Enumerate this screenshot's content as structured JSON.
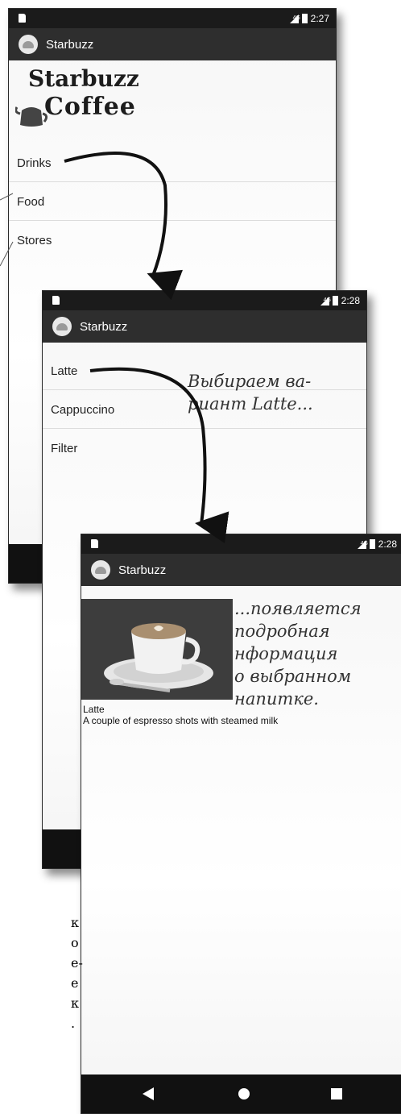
{
  "screen1": {
    "time": "2:27",
    "network": "4G",
    "app_title": "Starbuzz",
    "brand_line1": "Starbuzz",
    "brand_line2": "Coffee",
    "items": [
      {
        "label": "Drinks"
      },
      {
        "label": "Food"
      },
      {
        "label": "Stores"
      }
    ]
  },
  "screen2": {
    "time": "2:28",
    "network": "4G",
    "app_title": "Starbuzz",
    "items": [
      {
        "label": "Latte"
      },
      {
        "label": "Cappuccino"
      },
      {
        "label": "Filter"
      }
    ],
    "annotation": [
      "Выбираем ва-",
      "риант Latte..."
    ]
  },
  "screen3": {
    "time": "2:28",
    "network": "4G",
    "app_title": "Starbuzz",
    "drink_name": "Latte",
    "drink_description": "A couple of espresso shots with steamed milk",
    "annotation": [
      "...появляется",
      "подробная",
      "нформация",
      "о выбранном",
      "напитке."
    ]
  },
  "side_text": [
    "к",
    "о",
    "е-",
    "е",
    "к",
    "."
  ],
  "icons": {
    "back": "back-triangle-icon",
    "home": "home-circle-icon",
    "recents": "recents-square-icon"
  }
}
